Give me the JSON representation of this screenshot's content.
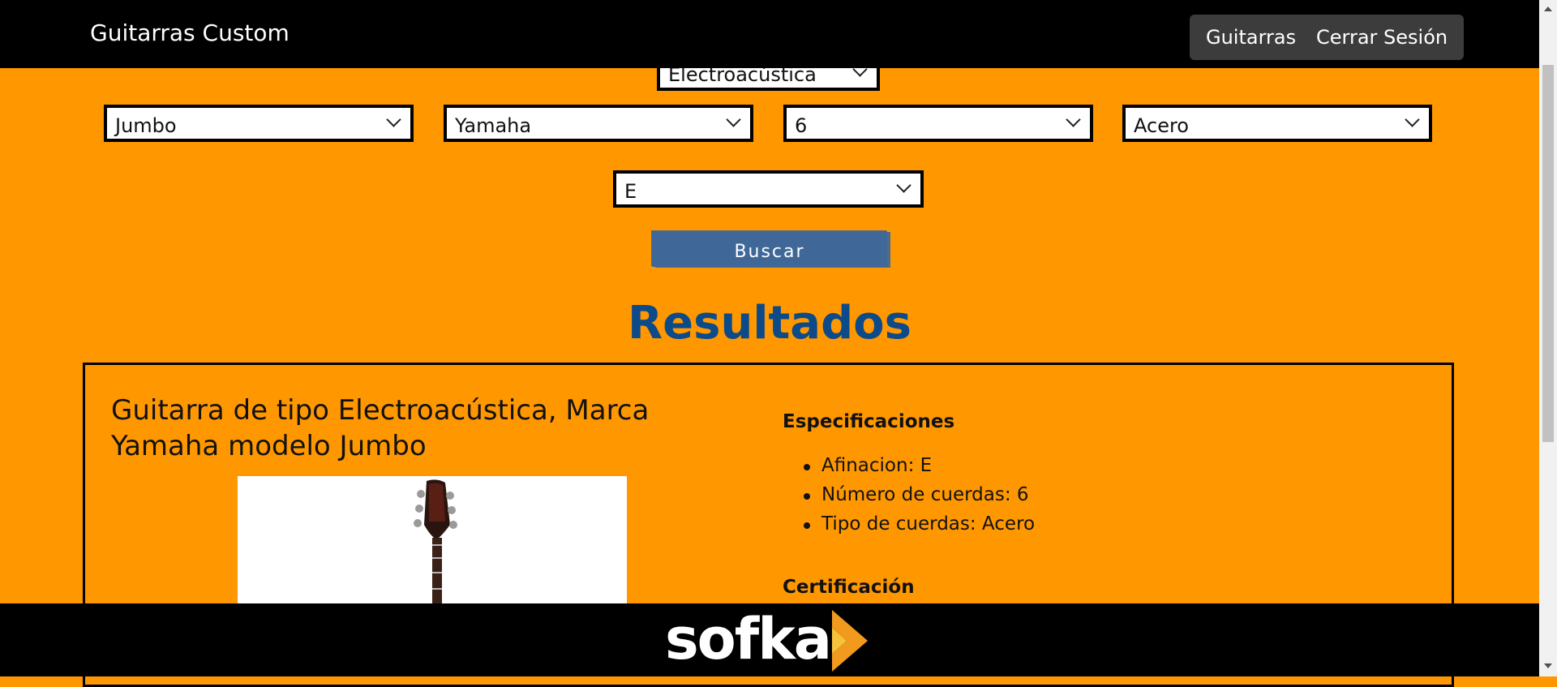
{
  "navbar": {
    "brand": "Guitarras Custom",
    "links": [
      "Guitarras",
      "Cerrar Sesión"
    ]
  },
  "filters": {
    "tipo": "Electroacústica",
    "modelo": "Jumbo",
    "marca": "Yamaha",
    "numero_cuerdas": "6",
    "tipo_cuerdas": "Acero",
    "afinacion": "E"
  },
  "search_button": "Buscar",
  "results": {
    "title": "Resultados",
    "card": {
      "title": "Guitarra de tipo Electroacústica, Marca Yamaha modelo Jumbo",
      "specs_heading": "Especificaciones",
      "specs": [
        "Afinacion: E",
        "Número de cuerdas: 6",
        "Tipo de cuerdas: Acero"
      ],
      "certification_heading": "Certificación"
    }
  },
  "footer": {
    "logo_text": "sofka"
  },
  "colors": {
    "page_background": "#ff9700",
    "navbar": "#000000",
    "button": "#3f6797",
    "title": "#0c4a8a"
  }
}
